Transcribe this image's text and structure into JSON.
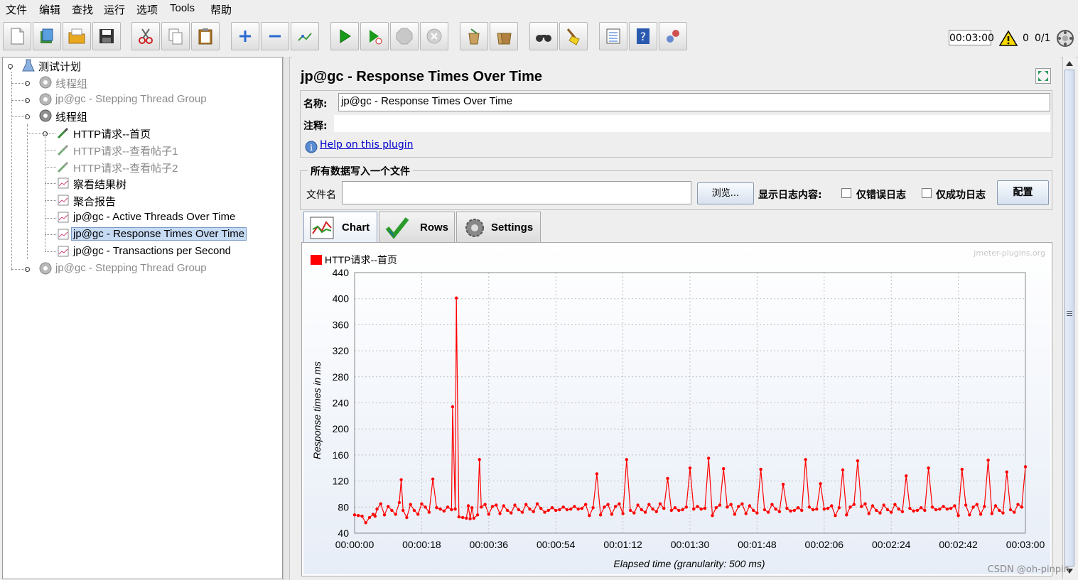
{
  "menu": [
    "文件",
    "编辑",
    "查找",
    "运行",
    "选项",
    "Tools",
    "帮助"
  ],
  "toolbar": {
    "icons": [
      "new-icon",
      "templates-icon",
      "open-icon",
      "save-icon",
      "cut-icon",
      "copy-icon",
      "paste-icon",
      "expand-all-icon",
      "collapse-all-icon",
      "toggle-icon",
      "start-icon",
      "start-no-pause-icon",
      "stop-icon",
      "shutdown-icon",
      "clear-icon",
      "clear-all-icon",
      "search-icon",
      "reset-search-icon",
      "function-helper-icon",
      "help-icon",
      "remote-icon"
    ],
    "timer": "00:03:00",
    "warning_count": "0",
    "threads": "0/1"
  },
  "tree": {
    "nodes": [
      {
        "label": "测试计划",
        "icon": "test-plan-icon",
        "state": "normal"
      },
      {
        "label": "线程组",
        "icon": "gear-icon",
        "state": "disabled"
      },
      {
        "label": "jp@gc - Stepping Thread Group",
        "icon": "gear-icon",
        "state": "disabled"
      },
      {
        "label": "线程组",
        "icon": "gear-icon",
        "state": "normal"
      },
      {
        "label": "HTTP请求--首页",
        "icon": "pipette-icon",
        "state": "normal"
      },
      {
        "label": "HTTP请求--查看帖子1",
        "icon": "pipette-icon",
        "state": "disabled"
      },
      {
        "label": "HTTP请求--查看帖子2",
        "icon": "pipette-icon",
        "state": "disabled"
      },
      {
        "label": "察看结果树",
        "icon": "listener-icon",
        "state": "normal"
      },
      {
        "label": "聚合报告",
        "icon": "listener-icon",
        "state": "normal"
      },
      {
        "label": "jp@gc - Active Threads Over Time",
        "icon": "listener-icon",
        "state": "normal"
      },
      {
        "label": "jp@gc - Response Times Over Time",
        "icon": "listener-icon",
        "state": "selected"
      },
      {
        "label": "jp@gc - Transactions per Second",
        "icon": "listener-icon",
        "state": "normal"
      },
      {
        "label": "jp@gc - Stepping Thread Group",
        "icon": "gear-icon",
        "state": "disabled"
      }
    ]
  },
  "panel": {
    "title": "jp@gc - Response Times Over Time",
    "name_label": "名称:",
    "name_value": "jp@gc - Response Times Over Time",
    "comment_label": "注释:",
    "comment_value": "",
    "help_link": "Help on this plugin",
    "file_group_title": "所有数据写入一个文件",
    "file_label": "文件名",
    "file_value": "",
    "browse_button": "浏览...",
    "log_label": "显示日志内容:",
    "errors_only": "仅错误日志",
    "success_only": "仅成功日志",
    "config_button": "配置",
    "tabs": [
      "Chart",
      "Rows",
      "Settings"
    ]
  },
  "chart_data": {
    "type": "line",
    "watermark": "jmeter-plugins.org",
    "xlabel": "Elapsed time (granularity: 500 ms)",
    "ylabel": "Response times in ms",
    "ylim": [
      40,
      440
    ],
    "yticks": [
      "40",
      "80",
      "120",
      "160",
      "200",
      "240",
      "280",
      "320",
      "360",
      "400",
      "440"
    ],
    "xticks": [
      "00:00:00",
      "00:00:18",
      "00:00:36",
      "00:00:54",
      "00:01:12",
      "00:01:30",
      "00:01:48",
      "00:02:06",
      "00:02:24",
      "00:02:42",
      "00:03:00"
    ],
    "xlim_seconds": [
      0,
      180
    ],
    "grid": true,
    "legend": "top-left",
    "series": [
      {
        "name": "HTTP请求--首页",
        "color": "#ff0000",
        "points": [
          [
            0,
            68
          ],
          [
            1,
            67
          ],
          [
            2,
            66
          ],
          [
            3,
            68
          ],
          [
            4,
            64
          ],
          [
            5,
            65
          ],
          [
            5.5,
            77
          ],
          [
            6,
            76
          ],
          [
            7,
            80
          ],
          [
            8,
            78
          ],
          [
            9,
            79
          ],
          [
            10,
            80
          ],
          [
            11,
            78
          ],
          [
            12,
            84
          ],
          [
            13,
            79
          ],
          [
            14,
            72
          ],
          [
            15,
            80
          ],
          [
            16,
            78
          ],
          [
            17,
            76
          ],
          [
            18,
            80
          ],
          [
            19,
            82
          ],
          [
            20,
            78
          ],
          [
            21,
            80
          ],
          [
            22,
            80
          ],
          [
            23,
            82
          ],
          [
            24,
            78
          ],
          [
            25,
            80
          ],
          [
            26,
            80
          ],
          [
            27,
            80
          ],
          [
            28,
            80
          ],
          [
            29,
            80
          ],
          [
            30,
            80
          ],
          [
            30.5,
            80
          ],
          [
            31,
            82
          ],
          [
            31.5,
            80
          ],
          [
            32,
            80
          ],
          [
            33,
            80
          ],
          [
            34,
            80
          ],
          [
            35,
            80
          ],
          [
            36,
            80
          ],
          [
            37,
            80
          ],
          [
            38,
            78
          ],
          [
            39,
            80
          ],
          [
            40,
            80
          ],
          [
            41,
            80
          ],
          [
            42,
            80
          ],
          [
            43,
            80
          ],
          [
            44,
            80
          ],
          [
            45,
            80
          ],
          [
            46,
            80
          ],
          [
            47,
            80
          ],
          [
            48,
            80
          ],
          [
            49,
            80
          ],
          [
            50,
            80
          ],
          [
            51,
            78
          ],
          [
            52,
            80
          ],
          [
            53,
            80
          ],
          [
            54,
            80
          ],
          [
            55,
            80
          ],
          [
            56,
            80
          ],
          [
            57,
            80
          ],
          [
            58,
            80
          ],
          [
            59,
            80
          ],
          [
            60,
            80
          ],
          [
            61,
            80
          ],
          [
            62,
            82
          ],
          [
            63,
            80
          ],
          [
            64,
            80
          ],
          [
            65,
            80
          ],
          [
            66,
            80
          ],
          [
            67,
            80
          ],
          [
            68,
            80
          ],
          [
            69,
            80
          ],
          [
            70,
            80
          ],
          [
            71,
            80
          ],
          [
            72,
            80
          ],
          [
            73,
            80
          ],
          [
            74,
            80
          ],
          [
            75,
            80
          ],
          [
            76,
            80
          ],
          [
            77,
            80
          ],
          [
            78,
            80
          ],
          [
            79,
            80
          ],
          [
            80,
            80
          ],
          [
            81,
            80
          ],
          [
            82,
            80
          ],
          [
            83,
            80
          ],
          [
            84,
            80
          ],
          [
            85,
            80
          ],
          [
            86,
            80
          ],
          [
            87,
            80
          ],
          [
            88,
            80
          ],
          [
            89,
            80
          ],
          [
            90,
            80
          ],
          [
            91,
            80
          ],
          [
            92,
            80
          ],
          [
            93,
            80
          ],
          [
            94,
            80
          ],
          [
            95,
            80
          ],
          [
            96,
            80
          ],
          [
            97,
            80
          ],
          [
            98,
            80
          ],
          [
            99,
            80
          ],
          [
            100,
            80
          ],
          [
            101,
            80
          ],
          [
            102,
            80
          ],
          [
            103,
            80
          ],
          [
            104,
            80
          ],
          [
            105,
            80
          ],
          [
            106,
            80
          ],
          [
            107,
            80
          ],
          [
            108,
            80
          ],
          [
            109,
            80
          ],
          [
            110,
            80
          ],
          [
            111,
            80
          ],
          [
            112,
            80
          ],
          [
            113,
            80
          ],
          [
            114,
            80
          ],
          [
            115,
            80
          ],
          [
            116,
            80
          ],
          [
            117,
            80
          ],
          [
            118,
            80
          ],
          [
            119,
            80
          ],
          [
            120,
            80
          ],
          [
            121,
            80
          ],
          [
            122,
            80
          ],
          [
            123,
            80
          ],
          [
            124,
            80
          ],
          [
            125,
            80
          ],
          [
            126,
            80
          ],
          [
            127,
            80
          ],
          [
            128,
            80
          ],
          [
            129,
            80
          ],
          [
            130,
            80
          ],
          [
            131,
            80
          ],
          [
            132,
            80
          ],
          [
            133,
            80
          ],
          [
            134,
            80
          ],
          [
            135,
            80
          ],
          [
            136,
            80
          ],
          [
            137,
            80
          ],
          [
            138,
            80
          ],
          [
            139,
            80
          ],
          [
            140,
            80
          ],
          [
            141,
            80
          ],
          [
            142,
            80
          ],
          [
            143,
            80
          ],
          [
            144,
            80
          ],
          [
            145,
            80
          ],
          [
            146,
            80
          ],
          [
            147,
            80
          ],
          [
            148,
            80
          ],
          [
            149,
            80
          ],
          [
            150,
            80
          ],
          [
            151,
            80
          ],
          [
            152,
            80
          ],
          [
            153,
            80
          ],
          [
            154,
            80
          ],
          [
            155,
            80
          ],
          [
            156,
            80
          ],
          [
            157,
            80
          ],
          [
            158,
            80
          ],
          [
            159,
            80
          ],
          [
            160,
            80
          ],
          [
            161,
            80
          ],
          [
            162,
            80
          ],
          [
            163,
            80
          ],
          [
            164,
            80
          ],
          [
            165,
            80
          ],
          [
            166,
            80
          ],
          [
            167,
            80
          ],
          [
            168,
            80
          ],
          [
            169,
            80
          ],
          [
            170,
            80
          ],
          [
            171,
            80
          ],
          [
            172,
            80
          ],
          [
            173,
            80
          ],
          [
            174,
            80
          ],
          [
            175,
            80
          ],
          [
            176,
            80
          ],
          [
            177,
            80
          ],
          [
            178,
            80
          ],
          [
            179,
            80
          ],
          [
            180,
            142
          ]
        ],
        "spikes": [
          [
            12.5,
            122
          ],
          [
            21,
            123
          ],
          [
            26.3,
            234
          ],
          [
            27.3,
            401
          ],
          [
            33.5,
            153
          ],
          [
            65,
            131
          ],
          [
            73,
            153
          ],
          [
            84,
            124
          ],
          [
            90,
            140
          ],
          [
            95,
            155
          ],
          [
            99,
            139
          ],
          [
            109,
            138
          ],
          [
            115,
            115
          ],
          [
            121,
            153
          ],
          [
            125,
            116
          ],
          [
            131,
            137
          ],
          [
            135,
            151
          ],
          [
            148,
            128
          ],
          [
            154,
            140
          ],
          [
            163,
            138
          ],
          [
            170,
            152
          ],
          [
            175,
            134
          ]
        ],
        "dips": [
          [
            28,
            65
          ],
          [
            29,
            64
          ],
          [
            30,
            63
          ],
          [
            31,
            62
          ],
          [
            32,
            63
          ]
        ]
      }
    ]
  },
  "watermark": "CSDN @oh-pinpin"
}
